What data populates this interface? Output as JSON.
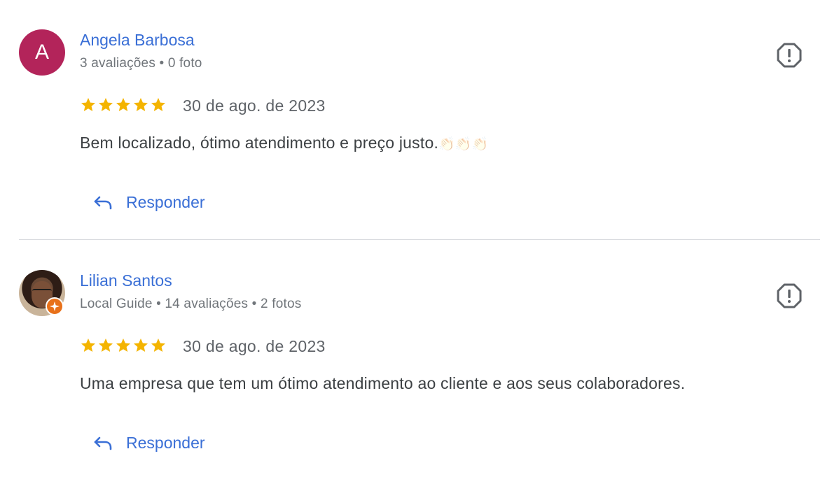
{
  "reviews": [
    {
      "author": {
        "name": "Angela Barbosa",
        "avatar_letter": "A",
        "avatar_color": "#b3245a",
        "meta": "3 avaliações • 0 foto"
      },
      "rating": 5,
      "date": "30 de ago. de 2023",
      "text": "Bem localizado, ótimo atendimento e preço justo.",
      "emoji": "👏🏻👏🏻👏🏻",
      "reply_label": "Responder",
      "flag_icon": "report-icon"
    },
    {
      "author": {
        "name": "Lilian Santos",
        "avatar": "profile-photo",
        "badge": "local-guide-badge-icon",
        "meta": "Local Guide • 14 avaliações • 2 fotos"
      },
      "rating": 5,
      "date": "30 de ago. de 2023",
      "text": "Uma empresa que tem um ótimo atendimento ao cliente e aos seus colaboradores.",
      "reply_label": "Responder",
      "flag_icon": "report-icon"
    }
  ],
  "colors": {
    "link": "#3a6fd6",
    "star": "#f4b400",
    "meta": "#70757a",
    "divider": "#dadce0",
    "badge": "#e8711a"
  }
}
